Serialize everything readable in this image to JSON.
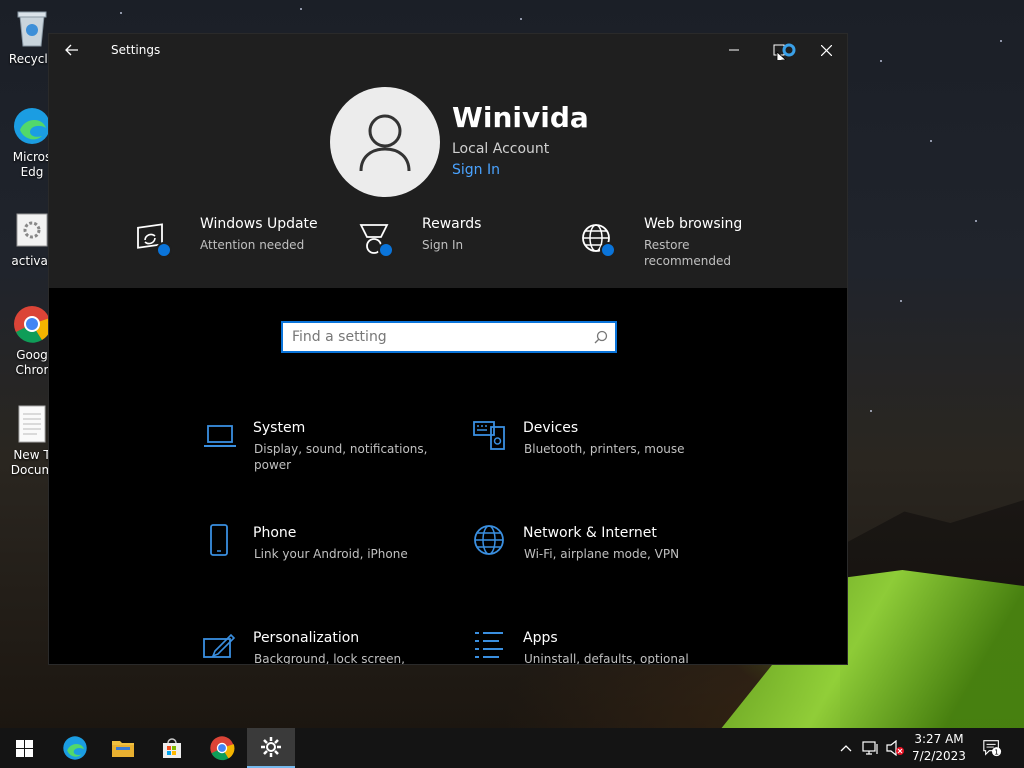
{
  "desktop": {
    "icons": [
      {
        "label": "Recycle"
      },
      {
        "label": "Micros\nEdg"
      },
      {
        "label": "activat"
      },
      {
        "label": "Goog\nChror"
      },
      {
        "label": "New T\nDocum"
      }
    ]
  },
  "window": {
    "title": "Settings",
    "user": {
      "name": "Winivida",
      "account_type": "Local Account",
      "sign_in": "Sign In"
    },
    "promos": [
      {
        "title": "Windows Update",
        "subtitle": "Attention needed"
      },
      {
        "title": "Rewards",
        "subtitle": "Sign In"
      },
      {
        "title": "Web browsing",
        "subtitle": "Restore recommended"
      }
    ],
    "search": {
      "placeholder": "Find a setting"
    },
    "categories": [
      {
        "title": "System",
        "subtitle": "Display, sound, notifications, power"
      },
      {
        "title": "Devices",
        "subtitle": "Bluetooth, printers, mouse"
      },
      {
        "title": "Phone",
        "subtitle": "Link your Android, iPhone"
      },
      {
        "title": "Network & Internet",
        "subtitle": "Wi-Fi, airplane mode, VPN"
      },
      {
        "title": "Personalization",
        "subtitle": "Background, lock screen, colors"
      },
      {
        "title": "Apps",
        "subtitle": "Uninstall, defaults, optional"
      }
    ]
  },
  "taskbar": {
    "clock": {
      "time": "3:27 AM",
      "date": "7/2/2023"
    },
    "notification_count": "1"
  },
  "colors": {
    "accent": "#0a74da",
    "link": "#4aa3ff",
    "icon_blue": "#3a8fe0"
  }
}
